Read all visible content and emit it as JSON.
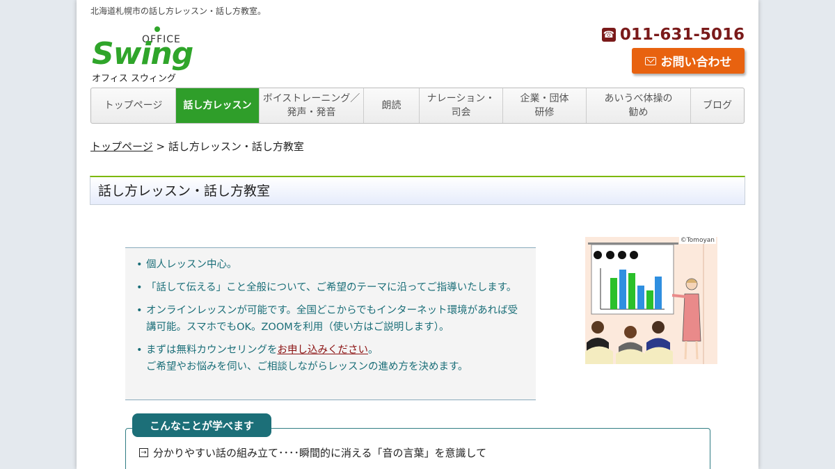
{
  "header": {
    "tagline": "北海道札幌市の話し方レッスン・話し方教室。",
    "logo": {
      "office": "OFFICE",
      "name": "Swing",
      "kana": "オフィス スウィング"
    },
    "phone": "011-631-5016",
    "contact_button": "お問い合わせ"
  },
  "nav": {
    "items": [
      {
        "label": "トップページ"
      },
      {
        "label": "話し方レッスン",
        "active": true
      },
      {
        "label": "ボイストレーニング／発声・発音"
      },
      {
        "label": "朗読"
      },
      {
        "label": "ナレーション・司会"
      },
      {
        "label": "企業・団体研修"
      },
      {
        "label": "あいうべ体操の勧め"
      },
      {
        "label": "ブログ"
      }
    ]
  },
  "breadcrumb": {
    "home": "トップページ",
    "separator": ">",
    "current": "話し方レッスン・話し方教室"
  },
  "main": {
    "title": "話し方レッスン・話し方教室",
    "bullets": [
      "個人レッスン中心。",
      "「話して伝える」こと全般について、ご希望のテーマに沿ってご指導いたします。",
      "オンラインレッスンが可能です。全国どこからでもインターネット環境があれば受講可能。スマホでもOK。ZOOMを利用（使い方はご説明します）。"
    ],
    "bullet4": {
      "prefix": "まずは無料カウンセリングを",
      "link": "お申し込みください",
      "suffix": "。",
      "line2": "ご希望やお悩みを伺い、ご相談しながらレッスンの進め方を決めます。"
    },
    "illustration_credit": "©Tomoyan",
    "learn": {
      "tab": "こんなことが学べます",
      "item1": "分かりやすい話の組み立て････瞬間的に消える「音の言葉」を意識して"
    }
  },
  "colors": {
    "accent_green": "#2f9e2a",
    "brand_green": "#2fa52a",
    "cta_orange": "#e8620f",
    "phone_red": "#7a1a1a",
    "teal": "#1c6f78"
  }
}
